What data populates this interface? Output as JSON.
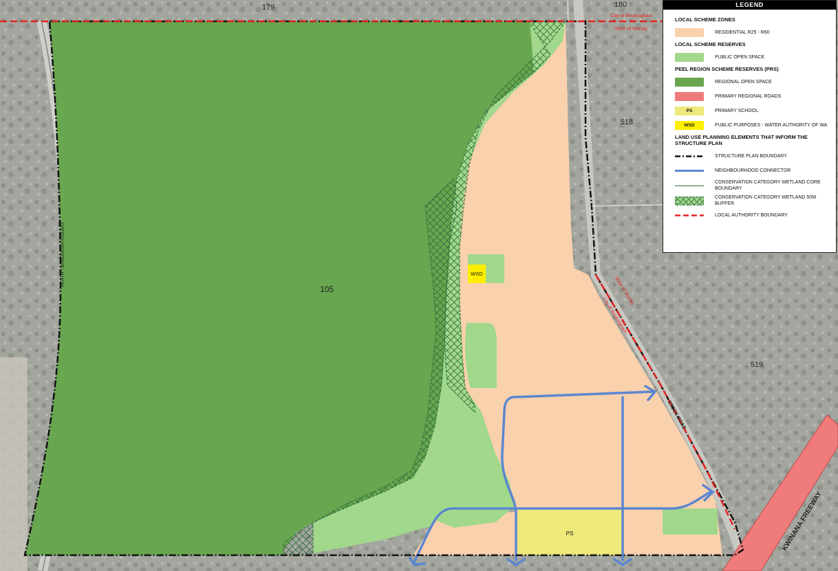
{
  "colors": {
    "regional_open_space": "#68a64f",
    "public_open_space": "#a2d88c",
    "residential": "#fad1ad",
    "primary_regional_roads": "#ef7b7b",
    "primary_school": "#eee97a",
    "public_purposes_water": "#ffee00",
    "neighbourhood_connector": "#5b86d1",
    "local_authority_boundary": "#e3231f",
    "wetland_hatch": "#2f6e3a"
  },
  "map": {
    "lot_labels": {
      "lot_179": "179",
      "lot_180": "180",
      "lot_518": "518",
      "lot_105": "105",
      "lot_519": "519"
    },
    "lga_labels": {
      "city_of_rockingham_top": "City of Rockingham",
      "shire_of_murray_top": "Shire of Murray",
      "shire_of_murray_side": "Shire of Murray",
      "city_of_rockingham_side": "City of Rockingham"
    },
    "road_labels": {
      "railway": "PERTH - MANDURAH RAILWAY",
      "stock_road": "STOCK   ROAD",
      "freeway": "KWINANA    FREEWAY"
    },
    "site_labels": {
      "wsd": "WSD",
      "ps": "PS"
    }
  },
  "legend": {
    "title": "LEGEND",
    "sections": {
      "local_scheme_zones": "LOCAL SCHEME ZONES",
      "local_scheme_reserves": "LOCAL SCHEME RESERVES",
      "peel_region": "PEEL REGION SCHEME RESERVES (PRS)",
      "land_use": "LAND USE PLANNING ELEMENTS THAT INFORM THE STRUCTURE PLAN"
    },
    "items": {
      "residential": "RESIDENTIAL R25 - R60",
      "public_open_space": "PUBLIC OPEN SPACE",
      "regional_open_space": "REGIONAL OPEN SPACE",
      "primary_regional_roads": "PRIMARY REGIONAL ROADS",
      "primary_school": "PRIMARY SCHOOL",
      "primary_school_code": "PS",
      "public_purposes": "PUBLIC PURPOSES - WATER AUTHORITY OF WA",
      "public_purposes_code": "WSD",
      "structure_plan_boundary": "STRUCTURE PLAN BOUNDARY",
      "neighbourhood_connector": "NEIGHBOURHOOD CONNECTOR",
      "wetland_core": "CONSERVATION CATEGORY WETLAND CORE BOUNDARY",
      "wetland_buffer": "CONSERVATION CATEGORY WETLAND 50m BUFFER",
      "local_authority_boundary": "LOCAL AUTHORITY BOUNDARY"
    }
  }
}
